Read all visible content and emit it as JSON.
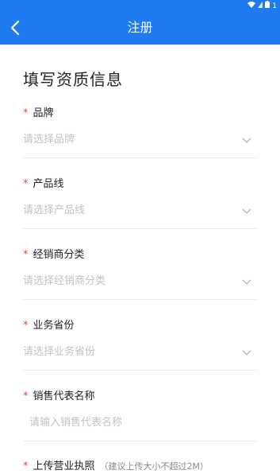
{
  "status": {
    "battery_label": "1"
  },
  "nav": {
    "title": "注册"
  },
  "section_title": "填写资质信息",
  "fields": [
    {
      "label": "品牌",
      "placeholder": "请选择品牌"
    },
    {
      "label": "产品线",
      "placeholder": "请选择产品线"
    },
    {
      "label": "经销商分类",
      "placeholder": "请选择经销商分类"
    },
    {
      "label": "业务省份",
      "placeholder": "请选择业务省份"
    },
    {
      "label": "销售代表名称",
      "placeholder": "请输入销售代表名称"
    },
    {
      "label": "上传营业执照",
      "hint": "（建议上传大小不超过2M）"
    }
  ],
  "colors": {
    "primary": "#1f7bf2",
    "required": "#e04a3f",
    "placeholder": "#c2c2c2"
  }
}
